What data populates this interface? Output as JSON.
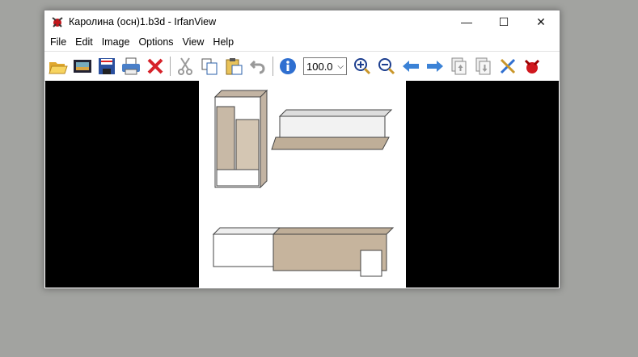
{
  "window": {
    "title": "Каролина (осн)1.b3d - IrfanView",
    "minimize": "—",
    "maximize": "☐",
    "close": "✕"
  },
  "menu": [
    "File",
    "Edit",
    "Image",
    "Options",
    "View",
    "Help"
  ],
  "toolbar": {
    "zoom_value": "100.0",
    "zoom_arrow": "⌵"
  },
  "colors": {
    "background": "#a2a3a0",
    "viewer": "#000000"
  }
}
